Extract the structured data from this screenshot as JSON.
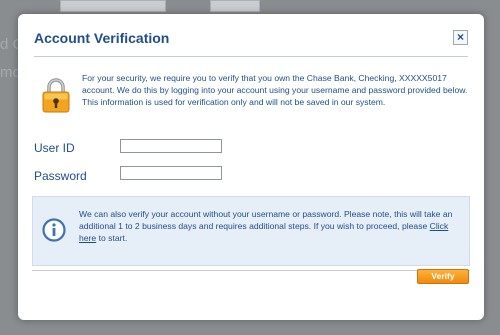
{
  "background": {
    "texts": [
      "d C",
      "mo"
    ]
  },
  "modal": {
    "title": "Account Verification",
    "close_label": "×",
    "security_message": "For your security, we require you to verify that you own the Chase Bank, Checking, XXXXX5017 account. We do this by logging into your account using your username and password provided below. This information is used for verification only and will not be saved in our system.",
    "user_id": {
      "label": "User ID",
      "value": ""
    },
    "password": {
      "label": "Password",
      "value": ""
    },
    "info": {
      "text_before_link": "We can also verify your account without your username or password. Please note, this will take an additional 1 to 2 business days and requires additional steps. If you wish to proceed, please ",
      "link_text": "Click here",
      "text_after_link": " to start."
    },
    "verify_label": "Verify"
  },
  "colors": {
    "title": "#1f4e8c",
    "verify_button": "#f7a21b",
    "info_panel": "#e6eef7",
    "backdrop": "#8a8d90"
  },
  "icons": {
    "lock": "lock-icon",
    "info": "info-icon",
    "close": "close-icon"
  }
}
